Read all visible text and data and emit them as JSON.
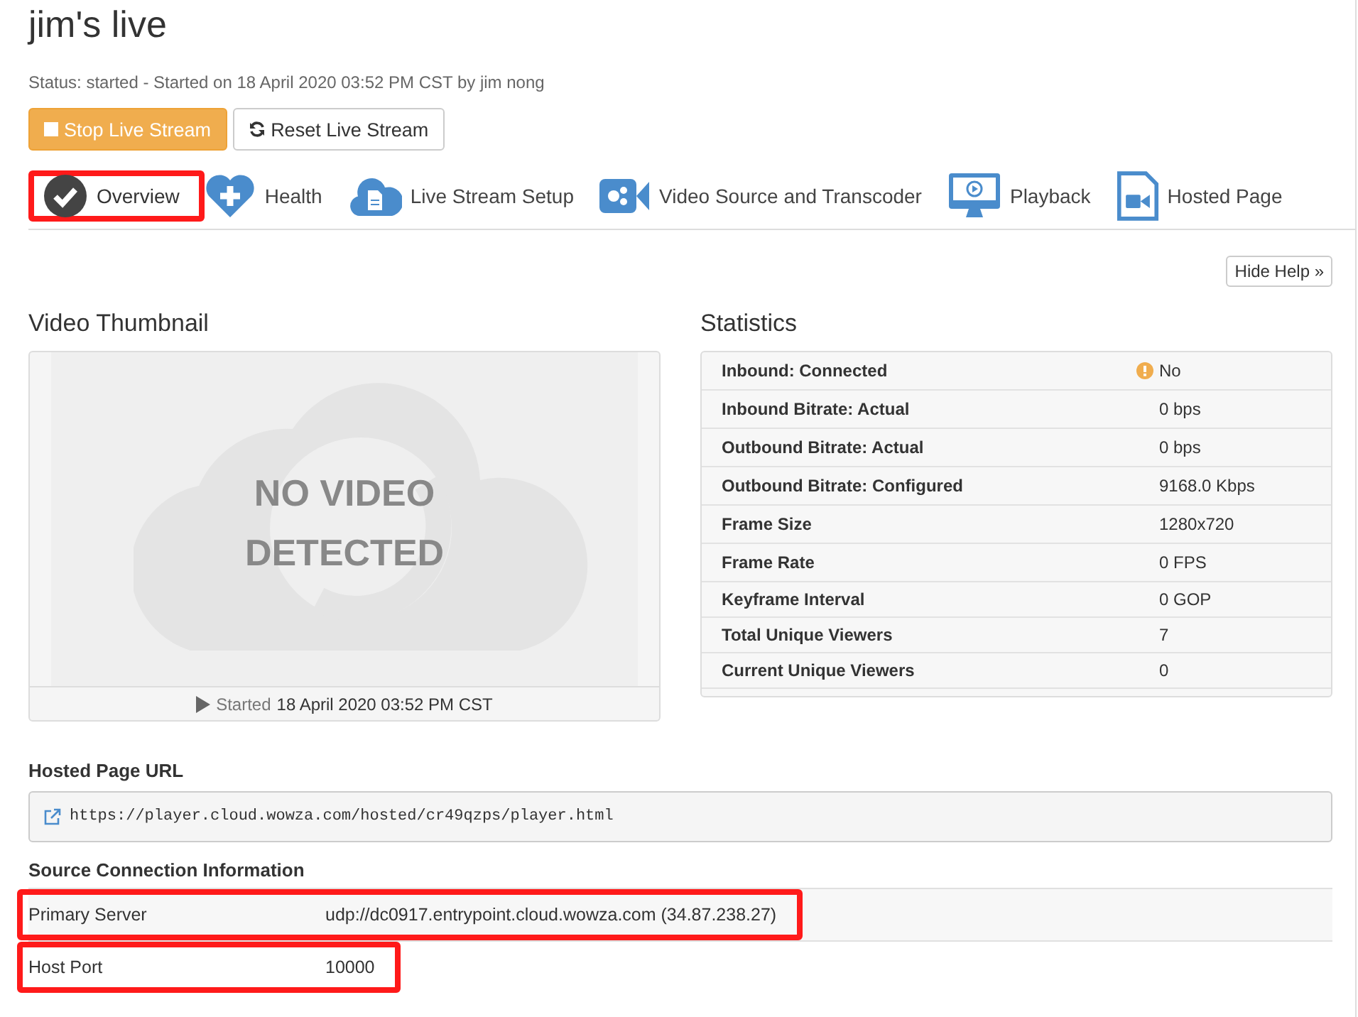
{
  "title": "jim's live",
  "status": "Status: started - Started on 18 April 2020 03:52 PM CST by jim nong",
  "actions": [
    {
      "kind": "stop",
      "label": "Stop Live Stream"
    },
    {
      "kind": "reset",
      "label": "Reset Live Stream"
    }
  ],
  "tabs": [
    {
      "kind": "check",
      "label": "Overview",
      "selected": true,
      "highlighted": true
    },
    {
      "kind": "heart",
      "label": "Health",
      "selected": false,
      "highlighted": false
    },
    {
      "kind": "cloud",
      "label": "Live Stream Setup",
      "selected": false,
      "highlighted": false
    },
    {
      "kind": "camera",
      "label": "Video Source and Transcoder",
      "selected": false,
      "highlighted": false
    },
    {
      "kind": "monitor",
      "label": "Playback",
      "selected": false,
      "highlighted": false
    },
    {
      "kind": "file",
      "label": "Hosted Page",
      "selected": false,
      "highlighted": false
    }
  ],
  "help_button": "Hide Help »",
  "thumbnail": {
    "heading": "Video Thumbnail",
    "placeholder_line1": "NO VIDEO",
    "placeholder_line2": "DETECTED",
    "caption_label": "Started",
    "caption_time": "18 April 2020 03:52 PM CST"
  },
  "statistics": {
    "heading": "Statistics",
    "rows": [
      {
        "label": "Inbound: Connected",
        "value": "No",
        "warning": true
      },
      {
        "label": "Inbound Bitrate: Actual",
        "value": "0 bps",
        "warning": false
      },
      {
        "label": "Outbound Bitrate: Actual",
        "value": "0 bps",
        "warning": false
      },
      {
        "label": "Outbound Bitrate: Configured",
        "value": "9168.0 Kbps",
        "warning": false
      },
      {
        "label": "Frame Size",
        "value": "1280x720",
        "warning": false
      },
      {
        "label": "Frame Rate",
        "value": "0 FPS",
        "warning": false
      },
      {
        "label": "Keyframe Interval",
        "value": "0 GOP",
        "warning": false
      },
      {
        "label": "Total Unique Viewers",
        "value": "7",
        "warning": false
      },
      {
        "label": "Current Unique Viewers",
        "value": "0",
        "warning": false
      }
    ]
  },
  "hosted_page": {
    "heading": "Hosted Page URL",
    "url": "https://player.cloud.wowza.com/hosted/cr49qzps/player.html"
  },
  "source_connection": {
    "heading": "Source Connection Information",
    "rows": [
      {
        "label": "Primary Server",
        "value": "udp://dc0917.entrypoint.cloud.wowza.com (34.87.238.27)",
        "highlighted": true
      },
      {
        "label": "Host Port",
        "value": "10000",
        "highlighted": true
      }
    ]
  }
}
